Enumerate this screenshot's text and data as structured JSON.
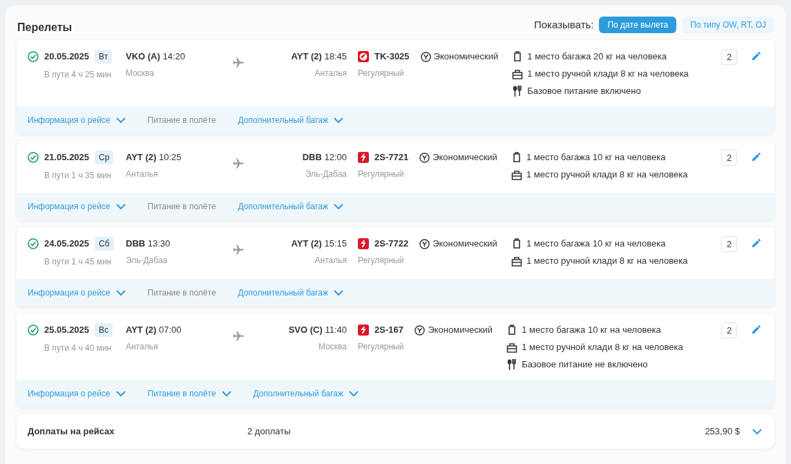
{
  "title": "Перелеты",
  "view_switch": {
    "label": "Показывать:",
    "options": [
      {
        "label": "По дате вылета",
        "selected": true
      },
      {
        "label": "По типу OW, RT, OJ",
        "selected": false
      }
    ]
  },
  "flights": [
    {
      "confirmed": true,
      "date": "20.05.2025",
      "weekday": "Вт",
      "duration": "В пути 4 ч 25 мин",
      "from_code": "VKO (A)",
      "from_time": "14:20",
      "from_city": "Москва",
      "to_code": "AYT (2)",
      "to_time": "18:45",
      "to_city": "Анталья",
      "airline_logo": {
        "kind": "round"
      },
      "flight_number": "TK-3025",
      "flight_type": "Регулярный",
      "cabin": "Экономический",
      "services": [
        {
          "kind": "baggage",
          "text": "1 место багажа 20 кг на человека"
        },
        {
          "kind": "hand",
          "text": "1 место ручной клади 8 кг на человека"
        },
        {
          "kind": "meal",
          "text": "Базовое питание включено"
        }
      ],
      "passengers": "2",
      "links": [
        {
          "label": "Информация о рейсе",
          "disabled": false
        },
        {
          "label": "Питание в полёте",
          "disabled": true
        },
        {
          "label": "Дополнительный багаж",
          "disabled": false
        }
      ]
    },
    {
      "confirmed": true,
      "date": "21.05.2025",
      "weekday": "Ср",
      "duration": "В пути 1 ч 35 мин",
      "from_code": "AYT (2)",
      "from_time": "10:25",
      "from_city": "Анталья",
      "to_code": "DBB",
      "to_time": "12:00",
      "to_city": "Эль-Дабаа",
      "airline_logo": {
        "kind": "square"
      },
      "flight_number": "2S-7721",
      "flight_type": "Регулярный",
      "cabin": "Экономический",
      "services": [
        {
          "kind": "baggage",
          "text": "1 место багажа 10 кг на человека"
        },
        {
          "kind": "hand",
          "text": "1 место ручной клади 8 кг на человека"
        }
      ],
      "passengers": "2",
      "links": [
        {
          "label": "Информация о рейсе",
          "disabled": false
        },
        {
          "label": "Питание в полёте",
          "disabled": true
        },
        {
          "label": "Дополнительный багаж",
          "disabled": false
        }
      ]
    },
    {
      "confirmed": true,
      "date": "24.05.2025",
      "weekday": "Сб",
      "duration": "В пути 1 ч 45 мин",
      "from_code": "DBB",
      "from_time": "13:30",
      "from_city": "Эль-Дабаа",
      "to_code": "AYT (2)",
      "to_time": "15:15",
      "to_city": "Анталья",
      "airline_logo": {
        "kind": "square"
      },
      "flight_number": "2S-7722",
      "flight_type": "Регулярный",
      "cabin": "Экономический",
      "services": [
        {
          "kind": "baggage",
          "text": "1 место багажа 10 кг на человека"
        },
        {
          "kind": "hand",
          "text": "1 место ручной клади 8 кг на человека"
        }
      ],
      "passengers": "2",
      "links": [
        {
          "label": "Информация о рейсе",
          "disabled": false
        },
        {
          "label": "Питание в полёте",
          "disabled": true
        },
        {
          "label": "Дополнительный багаж",
          "disabled": false
        }
      ]
    },
    {
      "confirmed": true,
      "date": "25.05.2025",
      "weekday": "Вс",
      "duration": "В пути 4 ч 40 мин",
      "from_code": "AYT (2)",
      "from_time": "07:00",
      "from_city": "Анталья",
      "to_code": "SVO (C)",
      "to_time": "11:40",
      "to_city": "Москва",
      "airline_logo": {
        "kind": "square"
      },
      "flight_number": "2S-167",
      "flight_type": "Регулярный",
      "cabin": "Экономический",
      "services": [
        {
          "kind": "baggage",
          "text": "1 место багажа 10 кг на человека"
        },
        {
          "kind": "hand",
          "text": "1 место ручной клади 8 кг на человека"
        },
        {
          "kind": "meal",
          "text": "Базовое питание не включено"
        }
      ],
      "passengers": "2",
      "links": [
        {
          "label": "Информация о рейсе",
          "disabled": false
        },
        {
          "label": "Питание в полёте",
          "disabled": false
        },
        {
          "label": "Дополнительный багаж",
          "disabled": false
        }
      ]
    }
  ],
  "surcharges": {
    "label": "Доплаты на рейсах",
    "count": "2 доплаты",
    "amount": "253,90 $",
    "expanded": false
  }
}
